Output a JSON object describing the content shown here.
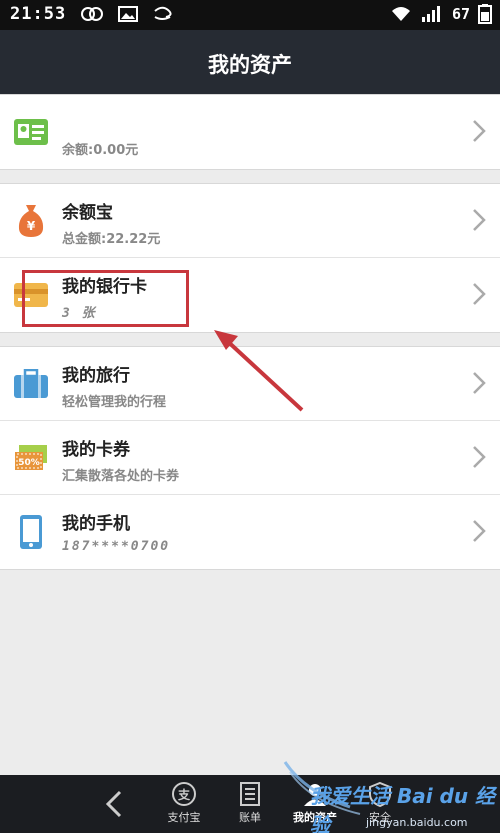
{
  "status_bar": {
    "time": "21:53",
    "battery": "67"
  },
  "header": {
    "title": "我的资产"
  },
  "groups": [
    {
      "items": [
        {
          "title": "",
          "subtitle": "余额:0.00元",
          "icon": "id-card-icon"
        }
      ]
    },
    {
      "items": [
        {
          "title": "余额宝",
          "subtitle": "总金额:22.22元",
          "icon": "money-bag-icon"
        },
        {
          "title": "我的银行卡",
          "subtitle": "3 张",
          "icon": "bank-card-icon"
        }
      ]
    },
    {
      "items": [
        {
          "title": "我的旅行",
          "subtitle": "轻松管理我的行程",
          "icon": "suitcase-icon"
        },
        {
          "title": "我的卡券",
          "subtitle": "汇集散落各处的卡券",
          "icon": "coupon-icon",
          "badge": "50%"
        },
        {
          "title": "我的手机",
          "subtitle": "187****0700",
          "icon": "phone-icon"
        }
      ]
    }
  ],
  "bottom_nav": {
    "tabs": [
      {
        "label": "支付宝",
        "icon": "alipay-icon"
      },
      {
        "label": "账单",
        "icon": "bill-icon"
      },
      {
        "label": "我的资产",
        "icon": "assets-icon",
        "active": true
      },
      {
        "label": "安全",
        "icon": "security-icon"
      }
    ]
  },
  "watermark": {
    "text": "我爱生活",
    "logo": "Bai du 经验",
    "url": "jingyan.baidu.com"
  },
  "colors": {
    "nav_bar": "#262b33",
    "highlight": "#c8373d",
    "green": "#6dbf4a",
    "orange": "#e8753a",
    "blue": "#4a9ad4"
  }
}
